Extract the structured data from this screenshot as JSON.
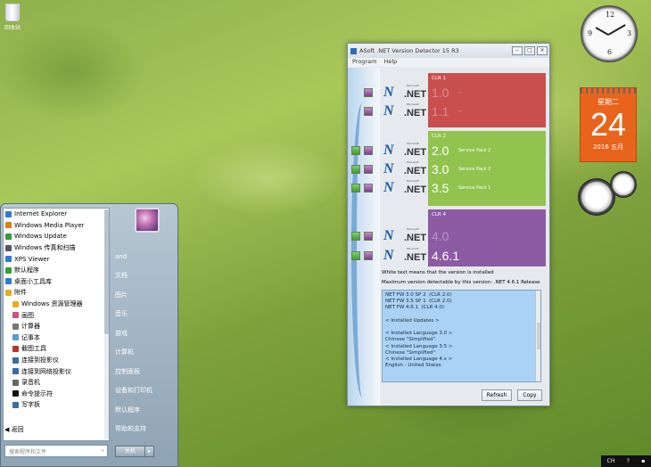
{
  "desktop": {
    "recycle_bin_label": "回收站"
  },
  "calendar": {
    "weekday": "星期二",
    "day": "24",
    "year_month": "2016 五月"
  },
  "clock": {
    "time": "10:10"
  },
  "start_menu": {
    "items": [
      {
        "label": "Internet Explorer",
        "color": "#2f7bd0",
        "sub": false
      },
      {
        "label": "Windows Media Player",
        "color": "#e07a1a",
        "sub": false
      },
      {
        "label": "Windows Update",
        "color": "#2f9f3a",
        "sub": false
      },
      {
        "label": "Windows 传真和扫描",
        "color": "#556",
        "sub": false
      },
      {
        "label": "XPS Viewer",
        "color": "#2f7bd0",
        "sub": false
      },
      {
        "label": "默认程序",
        "color": "#2f9f3a",
        "sub": false
      },
      {
        "label": "桌面小工具库",
        "color": "#2f7bd0",
        "sub": false
      },
      {
        "label": "附件",
        "color": "#e0b020",
        "sub": false
      },
      {
        "label": "Windows 资源管理器",
        "color": "#e0b020",
        "sub": true
      },
      {
        "label": "画图",
        "color": "#d04a8a",
        "sub": true
      },
      {
        "label": "计算器",
        "color": "#777",
        "sub": true
      },
      {
        "label": "记事本",
        "color": "#5a9ad8",
        "sub": true
      },
      {
        "label": "截图工具",
        "color": "#c03030",
        "sub": true
      },
      {
        "label": "连接到投影仪",
        "color": "#3a6aa8",
        "sub": true
      },
      {
        "label": "连接到网络投影仪",
        "color": "#3a6aa8",
        "sub": true
      },
      {
        "label": "录音机",
        "color": "#666",
        "sub": true
      },
      {
        "label": "命令提示符",
        "color": "#111",
        "sub": true
      },
      {
        "label": "写字板",
        "color": "#3a6aa8",
        "sub": true
      }
    ],
    "back_label": "返回",
    "search_placeholder": "搜索程序和文件",
    "right_items": [
      "and",
      "文档",
      "图片",
      "音乐",
      "游戏",
      "计算机",
      "控制面板",
      "设备和打印机",
      "默认程序",
      "帮助和支持"
    ],
    "shutdown_label": "关机"
  },
  "tray": {
    "lang": "CH"
  },
  "window": {
    "title": "ASoft .NET Version Detector 15 R3",
    "menu": [
      "Program",
      "Help"
    ],
    "net_logo_text": ".NET",
    "net_logo_ms": "Microsoft",
    "panels": [
      {
        "header": "CLR 1",
        "color": "#c94f4f",
        "versions": [
          {
            "num": "1.0",
            "desc": "--",
            "dim": true
          },
          {
            "num": "1.1",
            "desc": "--",
            "dim": true
          }
        ]
      },
      {
        "header": "CLR 2",
        "color": "#92c34f",
        "versions": [
          {
            "num": "2.0",
            "desc": "Service Pack 2",
            "dim": false
          },
          {
            "num": "3.0",
            "desc": "Service Pack 2",
            "dim": false
          },
          {
            "num": "3.5",
            "desc": "Service Pack 1",
            "dim": false
          }
        ]
      },
      {
        "header": "CLR 4",
        "color": "#8d5aa4",
        "versions": [
          {
            "num": "4.0",
            "desc": "",
            "dim": true
          },
          {
            "num": "4.6.1",
            "desc": "",
            "dim": false
          }
        ]
      }
    ],
    "note_white": "White text means that the version is installed",
    "note_max": "Maximum version detectable by this version: .NET 4.6.1 Release",
    "log_lines": [
      "NET FW 3.0 SP 2  (CLR 2.0)",
      "NET FW 3.5 SP 1  (CLR 2.0)",
      "NET FW 4.6.1  (CLR 4.0)",
      "",
      "< Installed Updates >",
      "",
      "< Installed Language 3.0 >",
      "Chinese \"Simplified\"",
      "< Installed Language 3.5 >",
      "Chinese \"Simplified\"",
      "< Installed Language 4.x >",
      "English - United States"
    ],
    "refresh_label": "Refresh",
    "copy_label": "Copy"
  }
}
